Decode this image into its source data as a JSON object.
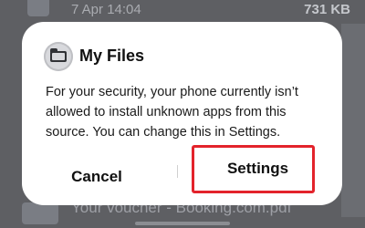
{
  "background": {
    "top_row": {
      "date": "7 Apr 14:04",
      "size": "731 KB"
    },
    "bottom_row": {
      "filename": "Your voucher - Booking.com.pdf"
    }
  },
  "dialog": {
    "app_icon": "folder-icon",
    "app_name": "My Files",
    "message": "For your security, your phone currently isn’t allowed to install unknown apps from this source. You can change this in Settings.",
    "cancel_label": "Cancel",
    "settings_label": "Settings"
  },
  "colors": {
    "highlight": "#e3232b",
    "dialog_bg": "#ffffff",
    "scrim": "#5e5f63"
  }
}
